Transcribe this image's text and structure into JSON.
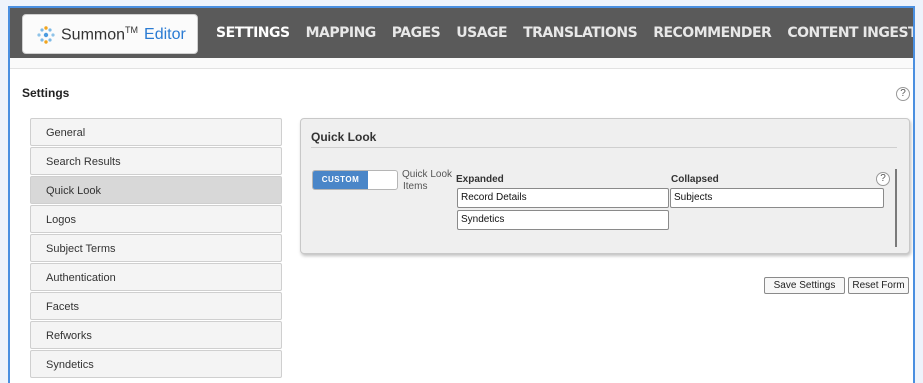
{
  "app": {
    "logo_name": "Summon",
    "logo_tm": "TM",
    "logo_editor": "Editor"
  },
  "nav": {
    "items": [
      {
        "label": "SETTINGS",
        "active": true
      },
      {
        "label": "MAPPING"
      },
      {
        "label": "PAGES"
      },
      {
        "label": "USAGE"
      },
      {
        "label": "TRANSLATIONS"
      },
      {
        "label": "RECOMMENDER"
      },
      {
        "label": "CONTENT INGESTION"
      }
    ]
  },
  "page": {
    "title": "Settings",
    "help_glyph": "?"
  },
  "sidebar": {
    "items": [
      {
        "label": "General"
      },
      {
        "label": "Search Results"
      },
      {
        "label": "Quick Look",
        "active": true
      },
      {
        "label": "Logos"
      },
      {
        "label": "Subject Terms"
      },
      {
        "label": "Authentication"
      },
      {
        "label": "Facets"
      },
      {
        "label": "Refworks"
      },
      {
        "label": "Syndetics"
      }
    ]
  },
  "quick_look": {
    "title": "Quick Look",
    "toggle_on_label": "CUSTOM",
    "items_label_line1": "Quick Look",
    "items_label_line2": "Items",
    "expanded_header": "Expanded",
    "collapsed_header": "Collapsed",
    "expanded": [
      "Record Details",
      "Syndetics"
    ],
    "collapsed": [
      "Subjects"
    ],
    "help_glyph": "?"
  },
  "actions": {
    "save_label": "Save Settings",
    "reset_label": "Reset Form"
  },
  "colors": {
    "accent": "#4a86c8",
    "topbar": "#5a5a5a",
    "frame_border": "#4a8fe0",
    "brand_editor": "#2a7bd3"
  },
  "icons": {
    "logo": "summon-dots-icon",
    "help": "help-icon"
  }
}
